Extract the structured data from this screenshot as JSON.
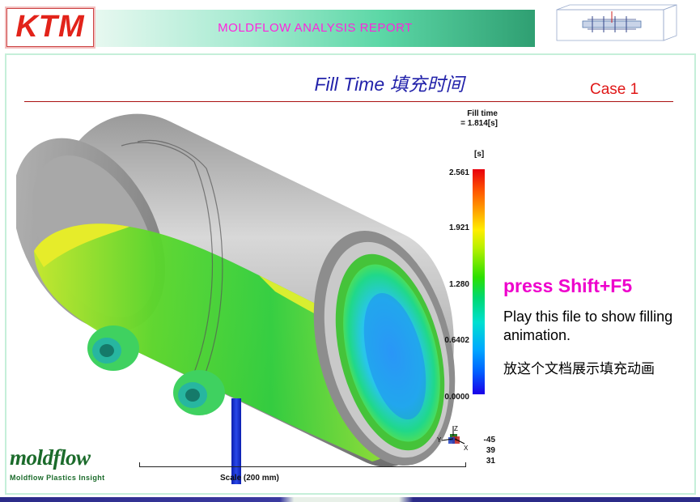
{
  "header": {
    "logo_text": "KTM",
    "banner_title": "MOLDFLOW  ANALYSIS REPORT"
  },
  "slide": {
    "title": "Fill Time 填充时间",
    "case_label": "Case 1"
  },
  "legend": {
    "title_line1": "Fill time",
    "title_line2": "= 1.814[s]",
    "unit": "[s]",
    "ticks": [
      "2.561",
      "1.921",
      "1.280",
      "0.6402",
      "0.0000"
    ]
  },
  "instructions": {
    "hotkey": "press Shift+F5",
    "play_text": "Play this file to show filling animation.",
    "chinese_text": "放这个文档展示填充动画"
  },
  "view": {
    "angles": [
      "-45",
      "39",
      "31"
    ],
    "axis_labels": [
      "Z",
      "Y",
      "X"
    ],
    "scale_label": "Scale (200 mm)"
  },
  "footer": {
    "brand": "moldflow",
    "brand_sub": "Moldflow Plastics Insight"
  },
  "colors": {
    "accent_magenta": "#ff22dd",
    "title_blue": "#2222aa",
    "case_red": "#e01818",
    "ktm_red": "#e2231a",
    "moldflow_green": "#1b6b2b"
  }
}
